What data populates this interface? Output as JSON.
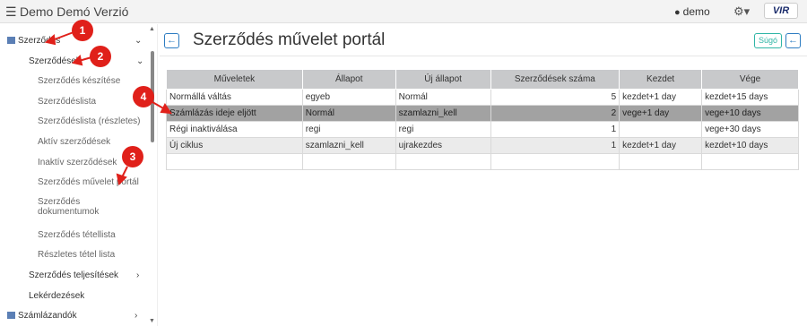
{
  "topbar": {
    "menu_icon": "☰",
    "title": "Demo Demó Verzió",
    "user_icon": "user-icon",
    "user": "demo",
    "settings_icon": "gear-icon",
    "logo_text": "VIR"
  },
  "sidebar": {
    "items": [
      {
        "label": "Szerződés",
        "chev": "⌄"
      },
      {
        "label": "Szerződések",
        "chev": "⌄"
      },
      {
        "label": "Szerződés készítése"
      },
      {
        "label": "Szerződéslista"
      },
      {
        "label": "Szerződéslista (részletes)"
      },
      {
        "label": "Aktív szerződések"
      },
      {
        "label": "Inaktív szerződések"
      },
      {
        "label": "Szerződés művelet portál"
      },
      {
        "label": "Szerződés"
      },
      {
        "label": "dokumentumok"
      },
      {
        "label": "Szerződés tétellista"
      },
      {
        "label": "Részletes tétel lista"
      },
      {
        "label": "Szerződés teljesítések",
        "chev": "›"
      },
      {
        "label": "Lekérdezések"
      },
      {
        "label": "Számlázandók",
        "chev": "›"
      }
    ]
  },
  "main": {
    "title": "Szerződés művelet portál",
    "help_label": "Súgó",
    "back_icon": "←"
  },
  "table": {
    "headers": [
      "Műveletek",
      "Állapot",
      "Új állapot",
      "Szerződések száma",
      "Kezdet",
      "Vége"
    ],
    "rows": [
      [
        "Normállá váltás",
        "egyeb",
        "Normál",
        "5",
        "kezdet+1 day",
        "kezdet+15 days"
      ],
      [
        "Számlázás ideje eljött",
        "Normál",
        "szamlazni_kell",
        "2",
        "vege+1 day",
        "vege+10 days"
      ],
      [
        "Régi inaktiválása",
        "regi",
        "regi",
        "1",
        "",
        "vege+30 days"
      ],
      [
        "Új ciklus",
        "szamlazni_kell",
        "ujrakezdes",
        "1",
        "kezdet+1 day",
        "kezdet+10 days"
      ],
      [
        "",
        "",
        "",
        "",
        "",
        ""
      ]
    ]
  },
  "callouts": [
    "1",
    "2",
    "3",
    "4"
  ],
  "colors": {
    "accent": "#2d7cc2",
    "callout": "#e0201a",
    "selected_row": "#a2a2a2",
    "header_bg": "#c8c9cb"
  }
}
